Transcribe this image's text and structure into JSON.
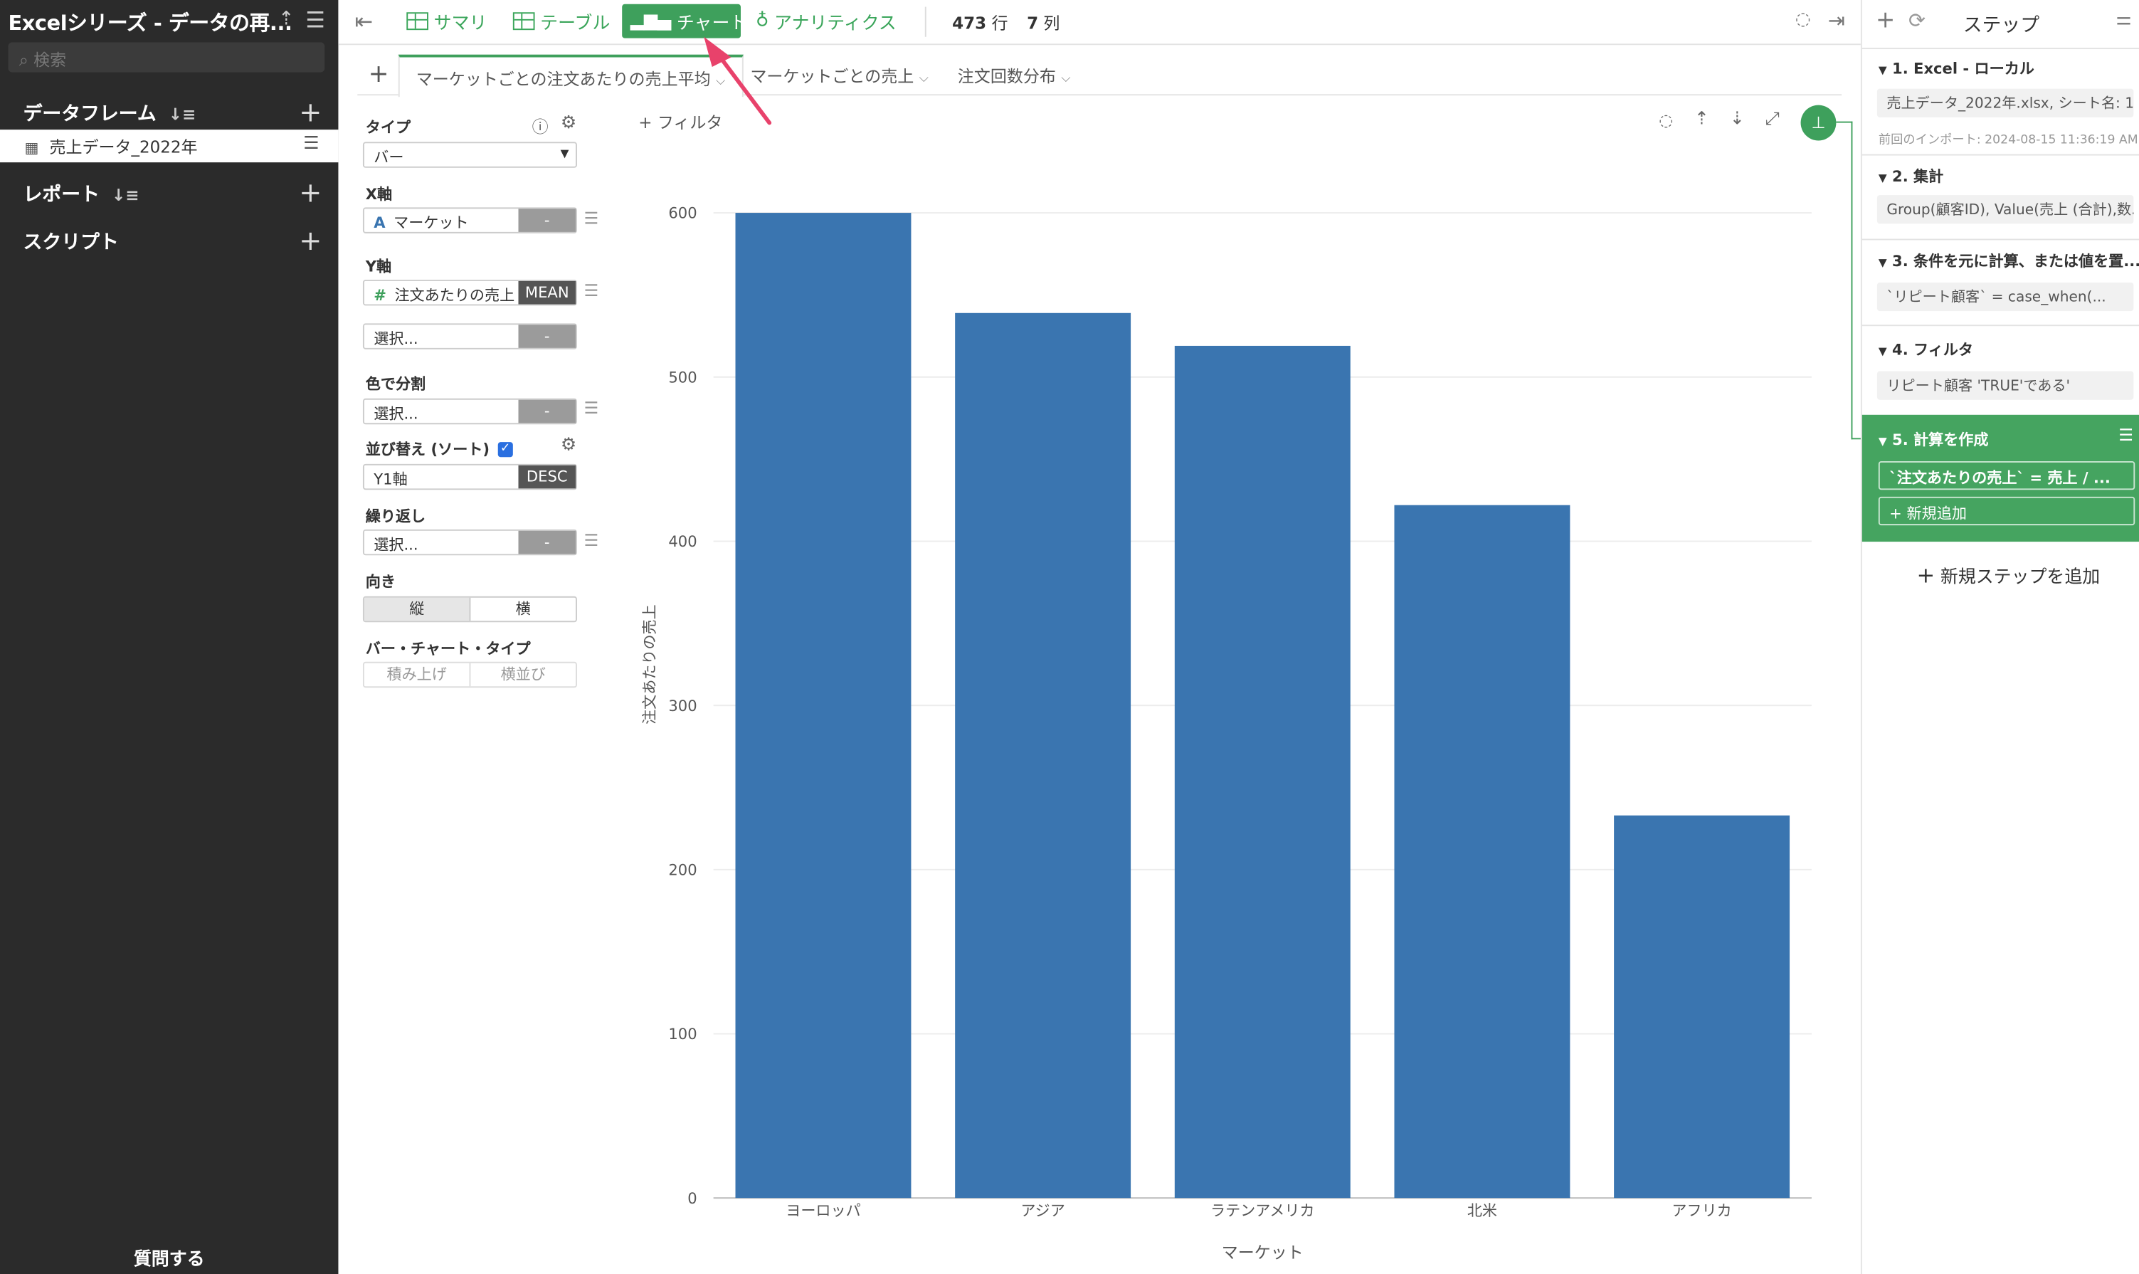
{
  "sidebar": {
    "title": "Excelシリーズ - データの再...",
    "search_placeholder": "検索",
    "dataframe_label": "データフレーム",
    "dataframe_item": "売上データ_2022年",
    "report_label": "レポート",
    "script_label": "スクリプト",
    "ask_label": "質問する"
  },
  "toolbar": {
    "summary": "サマリ",
    "table": "テーブル",
    "chart": "チャート",
    "analytics": "アナリティクス",
    "rows": "473",
    "rows_unit": "行",
    "cols": "7",
    "cols_unit": "列"
  },
  "tabs": [
    {
      "label": "マーケットごとの注文あたりの売上平均"
    },
    {
      "label": "マーケットごとの売上"
    },
    {
      "label": "注文回数分布"
    }
  ],
  "config": {
    "type_label": "タイプ",
    "type_value": "バー",
    "x_label": "X軸",
    "x_value": "マーケット",
    "x_btn": "-",
    "y_label": "Y軸",
    "y_value": "注文あたりの売上",
    "y_agg": "MEAN",
    "y2_value": "選択...",
    "y2_btn": "-",
    "color_label": "色で分割",
    "color_value": "選択...",
    "color_btn": "-",
    "sort_label": "並び替え (ソート)",
    "sort_value": "Y1軸",
    "sort_order": "DESC",
    "repeat_label": "繰り返し",
    "repeat_value": "選択...",
    "repeat_btn": "-",
    "orient_label": "向き",
    "orient_vertical": "縦",
    "orient_horizontal": "横",
    "bartype_label": "バー・チャート・タイプ",
    "bartype_stacked": "積み上げ",
    "bartype_side": "横並び"
  },
  "chart_toolbar": {
    "filter": "フィルタ"
  },
  "chart_data": {
    "type": "bar",
    "categories": [
      "ヨーロッパ",
      "アジア",
      "ラテンアメリカ",
      "北米",
      "アフリカ"
    ],
    "values": [
      600,
      539,
      519,
      422,
      233
    ],
    "xlabel": "マーケット",
    "ylabel": "注文あたりの売上",
    "ylim": [
      0,
      600
    ],
    "yticks": [
      "0",
      "100",
      "200",
      "300",
      "400",
      "500",
      "600"
    ],
    "bar_color": "#3a75b0",
    "grid": true
  },
  "steps": {
    "header": "ステップ",
    "items": [
      {
        "title": "1. Excel - ローカル",
        "detail": "売上データ_2022年.xlsx, シート名: 1",
        "note": "前回のインポート: 2024-08-15 11:36:19 AM"
      },
      {
        "title": "2. 集計",
        "detail": "Group(顧客ID), Value(売上 (合計),数..."
      },
      {
        "title": "3. 条件を元に計算、または値を置...",
        "detail": "`リピート顧客` = case_when(..."
      },
      {
        "title": "4. フィルタ",
        "detail": "リピート顧客 'TRUE'である'"
      },
      {
        "title": "5. 計算を作成",
        "detail": "`注文あたりの売上` = 売上 / ...",
        "add": "+ 新規追加"
      }
    ],
    "add_step": "新規ステップを追加"
  },
  "colors": {
    "sidebar_bg": "#2b2b2b",
    "accent_green": "#3ea05c",
    "bar_blue": "#3a75b0",
    "arrow_pink": "#e8426b"
  }
}
